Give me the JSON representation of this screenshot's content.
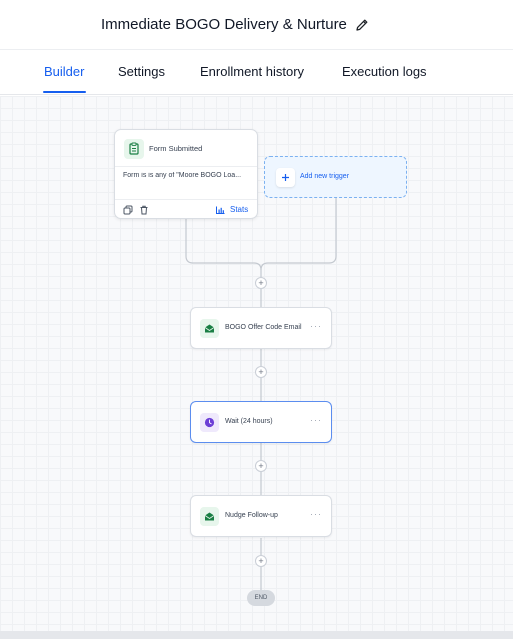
{
  "header": {
    "title": "Immediate BOGO Delivery & Nurture",
    "edit_icon": "pencil-icon"
  },
  "tabs": [
    {
      "label": "Builder",
      "active": true
    },
    {
      "label": "Settings",
      "active": false
    },
    {
      "label": "Enrollment history",
      "active": false
    },
    {
      "label": "Execution logs",
      "active": false
    }
  ],
  "trigger": {
    "title": "Form Submitted",
    "condition": "Form is is any of \"Moore BOGO Loa...",
    "stats_label": "Stats",
    "icon": "clipboard-icon"
  },
  "add_trigger": {
    "label": "Add new trigger",
    "icon": "plus-icon"
  },
  "steps": [
    {
      "label": "BOGO Offer Code Email",
      "icon": "envelope-open-icon",
      "color": "#1a7f44"
    },
    {
      "label": "Wait (24 hours)",
      "icon": "clock-icon",
      "color": "#6d3fd6"
    },
    {
      "label": "Nudge Follow-up",
      "icon": "envelope-open-icon",
      "color": "#1a7f44"
    }
  ],
  "plus_label": "+",
  "more_label": "···",
  "end_label": "END",
  "colors": {
    "accent": "#155eef",
    "email_green": "#1a7f44",
    "wait_purple": "#6d3fd6"
  }
}
